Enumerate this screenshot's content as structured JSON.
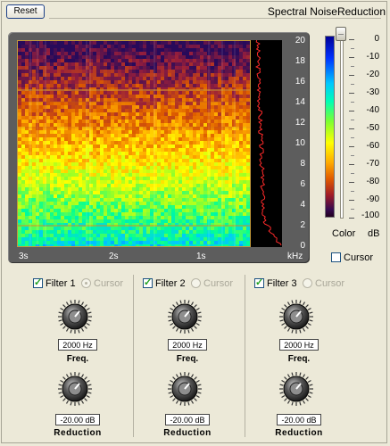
{
  "toolbar": {
    "reset_label": "Reset",
    "title": "Spectral NoiseReduction"
  },
  "spectrogram": {
    "khz_ticks": [
      "20",
      "18",
      "16",
      "14",
      "12",
      "10",
      "8",
      "6",
      "4",
      "2",
      "0"
    ],
    "time_labels": [
      "3s",
      "2s",
      "1s"
    ],
    "khz_unit": "kHz",
    "marker_color": "#d08a2a",
    "profile_color": "#ff2a2a"
  },
  "color_scale": {
    "db_ticks": [
      "0",
      "-10",
      "-20",
      "-30",
      "-40",
      "-50",
      "-60",
      "-70",
      "-80",
      "-90",
      "-100"
    ],
    "color_label": "Color",
    "db_label": "dB",
    "slider_value": 0
  },
  "cursor_main": {
    "label": "Cursor",
    "checked": false
  },
  "filters": [
    {
      "label": "Filter 1",
      "checked": true,
      "cursor_label": "Cursor",
      "cursor_selected": true,
      "freq_value": "2000 Hz",
      "freq_label": "Freq.",
      "reduction_value": "-20.00 dB",
      "reduction_label": "Reduction"
    },
    {
      "label": "Filter 2",
      "checked": true,
      "cursor_label": "Cursor",
      "cursor_selected": false,
      "freq_value": "2000 Hz",
      "freq_label": "Freq.",
      "reduction_value": "-20.00 dB",
      "reduction_label": "Reduction"
    },
    {
      "label": "Filter 3",
      "checked": true,
      "cursor_label": "Cursor",
      "cursor_selected": false,
      "freq_value": "2000 Hz",
      "freq_label": "Freq.",
      "reduction_value": "-20.00 dB",
      "reduction_label": "Reduction"
    }
  ]
}
